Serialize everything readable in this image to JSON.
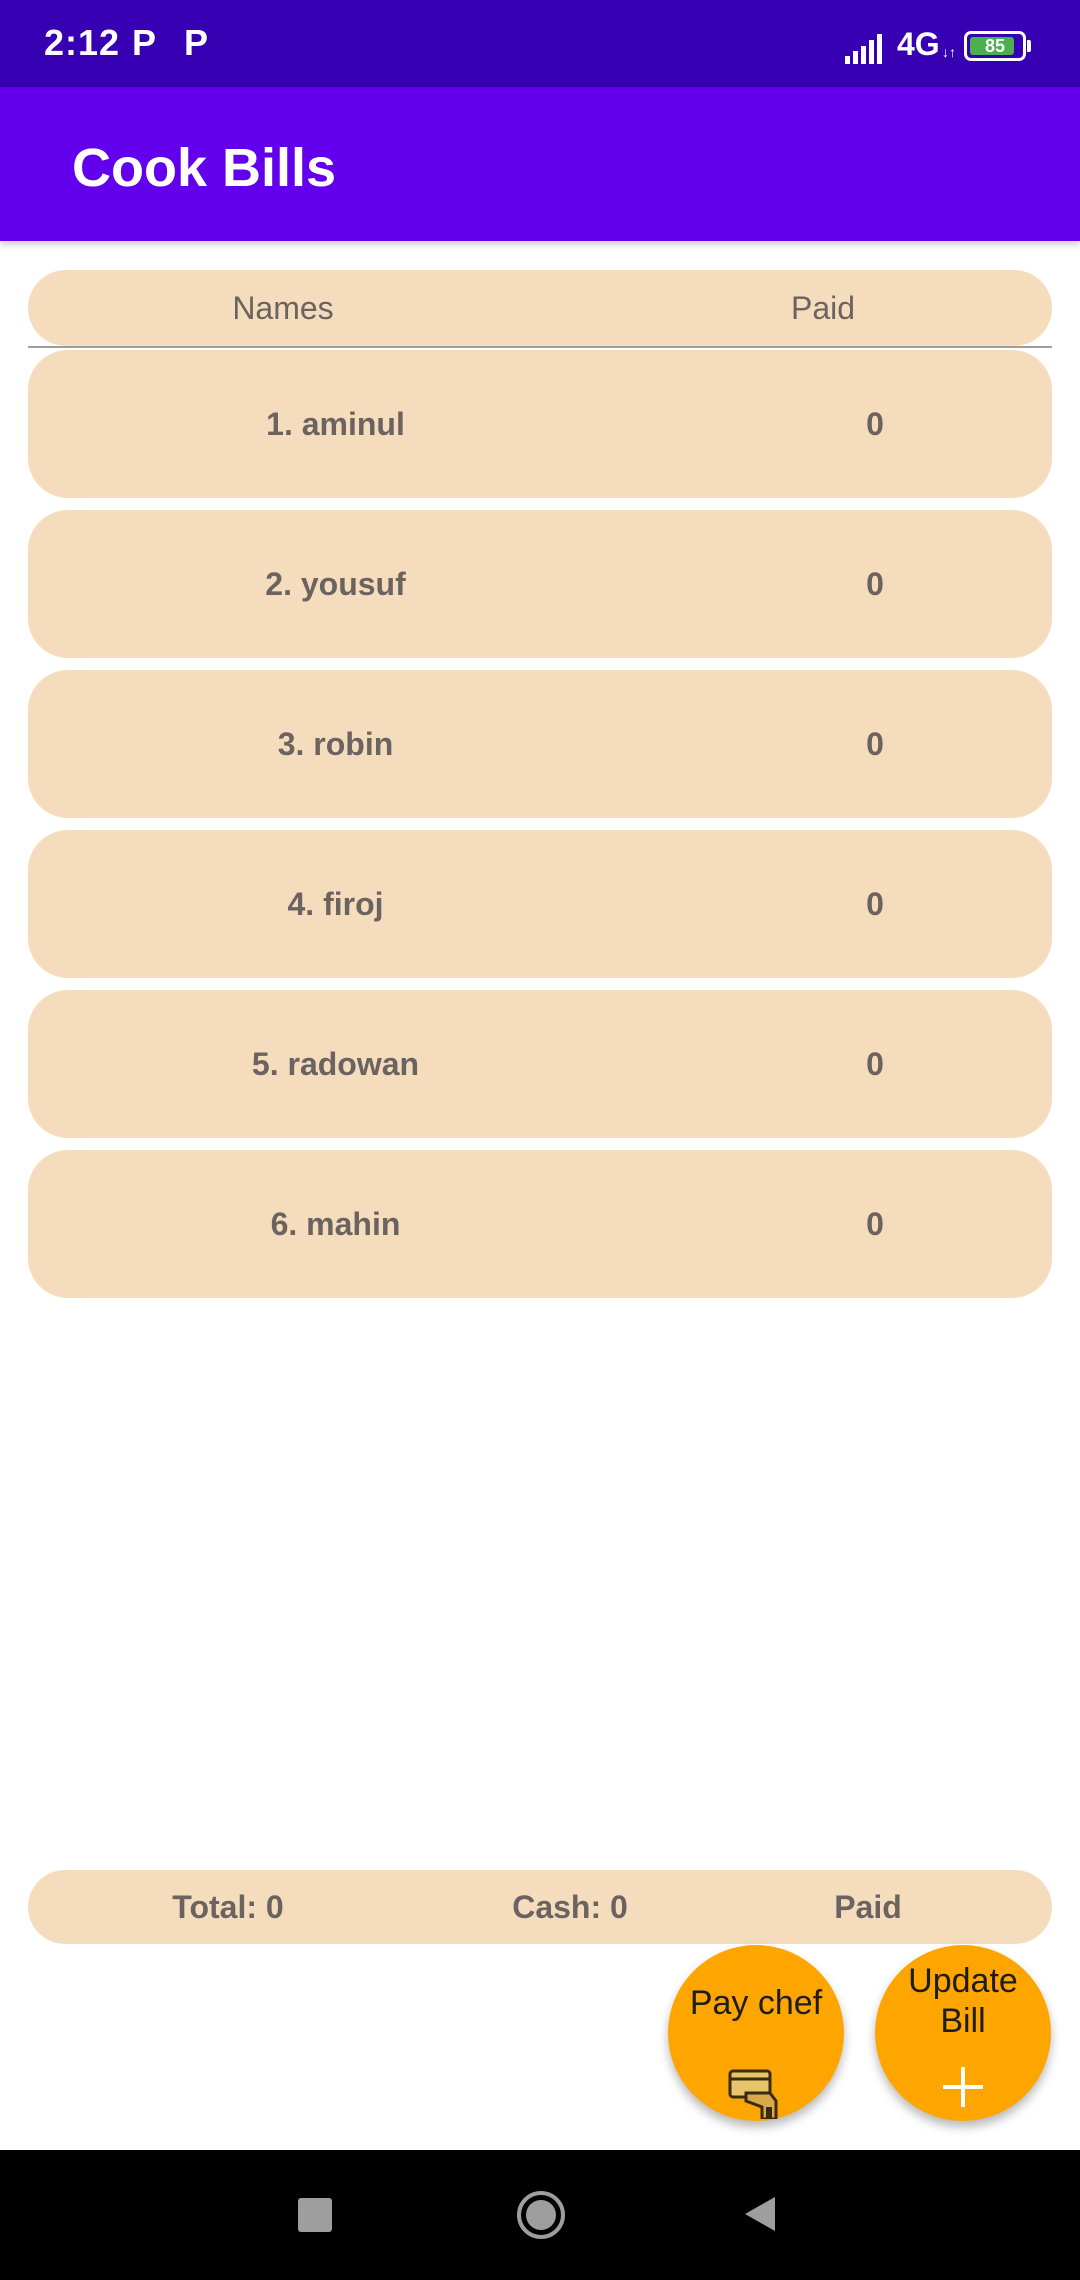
{
  "status_bar": {
    "time": "2:12",
    "notification_glyphs": [
      "P",
      "P"
    ],
    "network": "4G",
    "network_arrows": "↓↑",
    "battery_level": "85"
  },
  "app_bar": {
    "title": "Cook Bills"
  },
  "table": {
    "headers": {
      "names": "Names",
      "paid": "Paid"
    },
    "rows": [
      {
        "name": "1. aminul",
        "paid": "0"
      },
      {
        "name": "2. yousuf",
        "paid": "0"
      },
      {
        "name": "3. robin",
        "paid": "0"
      },
      {
        "name": "4. firoj",
        "paid": "0"
      },
      {
        "name": "5. radowan",
        "paid": "0"
      },
      {
        "name": "6. mahin",
        "paid": "0"
      }
    ]
  },
  "summary": {
    "total": "Total: 0",
    "cash": "Cash: 0",
    "paid": "Paid"
  },
  "fabs": {
    "pay_chef": {
      "label": "Pay chef",
      "icon": "wallet-hand-icon"
    },
    "update_bill": {
      "label_line1": "Update",
      "label_line2": "Bill",
      "icon": "plus-icon"
    }
  },
  "nav": {
    "recents_icon": "square-icon",
    "home_icon": "circle-icon",
    "back_icon": "triangle-icon"
  },
  "colors": {
    "status_bar": "#3700b3",
    "app_bar": "#6200ee",
    "row_background": "#f5dcbd",
    "fab": "#ffa500",
    "text_muted": "#6b6360"
  }
}
